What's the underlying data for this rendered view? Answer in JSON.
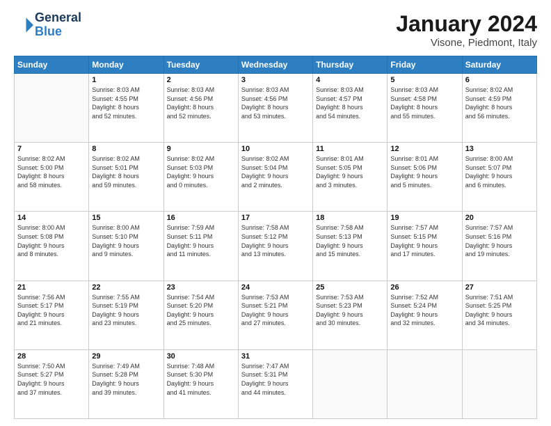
{
  "header": {
    "logo_general": "General",
    "logo_blue": "Blue",
    "main_title": "January 2024",
    "subtitle": "Visone, Piedmont, Italy"
  },
  "weekdays": [
    "Sunday",
    "Monday",
    "Tuesday",
    "Wednesday",
    "Thursday",
    "Friday",
    "Saturday"
  ],
  "weeks": [
    [
      {
        "num": "",
        "info": ""
      },
      {
        "num": "1",
        "info": "Sunrise: 8:03 AM\nSunset: 4:55 PM\nDaylight: 8 hours\nand 52 minutes."
      },
      {
        "num": "2",
        "info": "Sunrise: 8:03 AM\nSunset: 4:56 PM\nDaylight: 8 hours\nand 52 minutes."
      },
      {
        "num": "3",
        "info": "Sunrise: 8:03 AM\nSunset: 4:56 PM\nDaylight: 8 hours\nand 53 minutes."
      },
      {
        "num": "4",
        "info": "Sunrise: 8:03 AM\nSunset: 4:57 PM\nDaylight: 8 hours\nand 54 minutes."
      },
      {
        "num": "5",
        "info": "Sunrise: 8:03 AM\nSunset: 4:58 PM\nDaylight: 8 hours\nand 55 minutes."
      },
      {
        "num": "6",
        "info": "Sunrise: 8:02 AM\nSunset: 4:59 PM\nDaylight: 8 hours\nand 56 minutes."
      }
    ],
    [
      {
        "num": "7",
        "info": "Sunrise: 8:02 AM\nSunset: 5:00 PM\nDaylight: 8 hours\nand 58 minutes."
      },
      {
        "num": "8",
        "info": "Sunrise: 8:02 AM\nSunset: 5:01 PM\nDaylight: 8 hours\nand 59 minutes."
      },
      {
        "num": "9",
        "info": "Sunrise: 8:02 AM\nSunset: 5:03 PM\nDaylight: 9 hours\nand 0 minutes."
      },
      {
        "num": "10",
        "info": "Sunrise: 8:02 AM\nSunset: 5:04 PM\nDaylight: 9 hours\nand 2 minutes."
      },
      {
        "num": "11",
        "info": "Sunrise: 8:01 AM\nSunset: 5:05 PM\nDaylight: 9 hours\nand 3 minutes."
      },
      {
        "num": "12",
        "info": "Sunrise: 8:01 AM\nSunset: 5:06 PM\nDaylight: 9 hours\nand 5 minutes."
      },
      {
        "num": "13",
        "info": "Sunrise: 8:00 AM\nSunset: 5:07 PM\nDaylight: 9 hours\nand 6 minutes."
      }
    ],
    [
      {
        "num": "14",
        "info": "Sunrise: 8:00 AM\nSunset: 5:08 PM\nDaylight: 9 hours\nand 8 minutes."
      },
      {
        "num": "15",
        "info": "Sunrise: 8:00 AM\nSunset: 5:10 PM\nDaylight: 9 hours\nand 9 minutes."
      },
      {
        "num": "16",
        "info": "Sunrise: 7:59 AM\nSunset: 5:11 PM\nDaylight: 9 hours\nand 11 minutes."
      },
      {
        "num": "17",
        "info": "Sunrise: 7:58 AM\nSunset: 5:12 PM\nDaylight: 9 hours\nand 13 minutes."
      },
      {
        "num": "18",
        "info": "Sunrise: 7:58 AM\nSunset: 5:13 PM\nDaylight: 9 hours\nand 15 minutes."
      },
      {
        "num": "19",
        "info": "Sunrise: 7:57 AM\nSunset: 5:15 PM\nDaylight: 9 hours\nand 17 minutes."
      },
      {
        "num": "20",
        "info": "Sunrise: 7:57 AM\nSunset: 5:16 PM\nDaylight: 9 hours\nand 19 minutes."
      }
    ],
    [
      {
        "num": "21",
        "info": "Sunrise: 7:56 AM\nSunset: 5:17 PM\nDaylight: 9 hours\nand 21 minutes."
      },
      {
        "num": "22",
        "info": "Sunrise: 7:55 AM\nSunset: 5:19 PM\nDaylight: 9 hours\nand 23 minutes."
      },
      {
        "num": "23",
        "info": "Sunrise: 7:54 AM\nSunset: 5:20 PM\nDaylight: 9 hours\nand 25 minutes."
      },
      {
        "num": "24",
        "info": "Sunrise: 7:53 AM\nSunset: 5:21 PM\nDaylight: 9 hours\nand 27 minutes."
      },
      {
        "num": "25",
        "info": "Sunrise: 7:53 AM\nSunset: 5:23 PM\nDaylight: 9 hours\nand 30 minutes."
      },
      {
        "num": "26",
        "info": "Sunrise: 7:52 AM\nSunset: 5:24 PM\nDaylight: 9 hours\nand 32 minutes."
      },
      {
        "num": "27",
        "info": "Sunrise: 7:51 AM\nSunset: 5:25 PM\nDaylight: 9 hours\nand 34 minutes."
      }
    ],
    [
      {
        "num": "28",
        "info": "Sunrise: 7:50 AM\nSunset: 5:27 PM\nDaylight: 9 hours\nand 37 minutes."
      },
      {
        "num": "29",
        "info": "Sunrise: 7:49 AM\nSunset: 5:28 PM\nDaylight: 9 hours\nand 39 minutes."
      },
      {
        "num": "30",
        "info": "Sunrise: 7:48 AM\nSunset: 5:30 PM\nDaylight: 9 hours\nand 41 minutes."
      },
      {
        "num": "31",
        "info": "Sunrise: 7:47 AM\nSunset: 5:31 PM\nDaylight: 9 hours\nand 44 minutes."
      },
      {
        "num": "",
        "info": ""
      },
      {
        "num": "",
        "info": ""
      },
      {
        "num": "",
        "info": ""
      }
    ]
  ]
}
